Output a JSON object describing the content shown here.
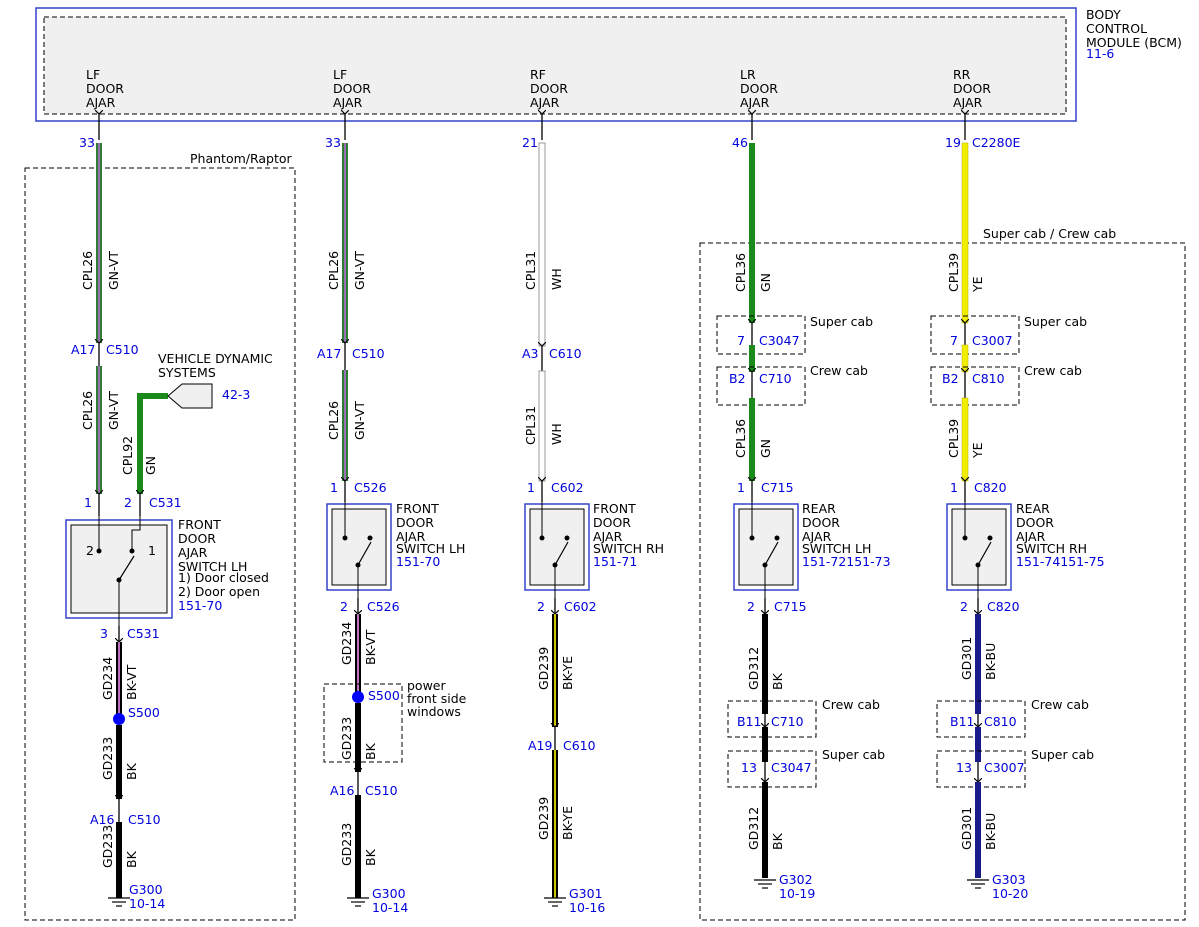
{
  "colors": {
    "gnvt_main": "#2e7d32",
    "gnvt_stripe": "#9b6fb5",
    "gn": "#1a8a1a",
    "wh": "#ffffff",
    "ye": "#f2ee00",
    "bkvt_stripe": "#c070c0",
    "bkye_stripe": "#cfc400",
    "bu": "#1a1a8a",
    "bk": "#000000",
    "ref": "#0000dd",
    "module_border": "#3344cc",
    "fill": "#f0f0f0"
  },
  "bcm": {
    "title_lines": [
      "BODY",
      "CONTROL",
      "MODULE (BCM)"
    ],
    "ref": "11-6",
    "pin_labels": [
      [
        "LF",
        "DOOR",
        "AJAR"
      ],
      [
        "LF",
        "DOOR",
        "AJAR"
      ],
      [
        "RF",
        "DOOR",
        "AJAR"
      ],
      [
        "LR",
        "DOOR",
        "AJAR"
      ],
      [
        "RR",
        "DOOR",
        "AJAR"
      ]
    ],
    "pin_numbers": [
      "33",
      "33",
      "21",
      "46",
      "19"
    ],
    "connector": "C2280E"
  },
  "regions": {
    "phantom": "Phantom/Raptor",
    "supercrew": "Super cab / Crew cab",
    "power_windows": [
      "power",
      "front side",
      "windows"
    ]
  },
  "vds": {
    "label_lines": [
      "VEHICLE DYNAMIC",
      "SYSTEMS"
    ],
    "ref": "42-3"
  },
  "wires": {
    "cpl26": "CPL26",
    "gnvt": "GN-VT",
    "cpl92": "CPL92",
    "gn": "GN",
    "cpl31": "CPL31",
    "wh": "WH",
    "cpl36": "CPL36",
    "cpl39": "CPL39",
    "ye": "YE",
    "gd234": "GD234",
    "bkvt": "BK-VT",
    "gd233": "GD233",
    "bk": "BK",
    "gd239": "GD239",
    "bkye": "BK-YE",
    "gd312": "GD312",
    "gd301": "GD301",
    "bkbu": "BK-BU"
  },
  "connectors": {
    "c510": "C510",
    "c610": "C610",
    "c531": "C531",
    "c526": "C526",
    "c602": "C602",
    "c715": "C715",
    "c820": "C820",
    "c3047": "C3047",
    "c3007": "C3007",
    "c710": "C710",
    "c810": "C810"
  },
  "pins": {
    "a17": "A17",
    "a3": "A3",
    "a16": "A16",
    "a19": "A19",
    "p1": "1",
    "p2": "2",
    "p3": "3",
    "p7": "7",
    "p13": "13",
    "b2": "B2",
    "b11": "B11"
  },
  "variants": {
    "super_cab": "Super cab",
    "crew_cab": "Crew cab"
  },
  "splices": {
    "s500": "S500"
  },
  "switches": {
    "lf1": {
      "lines": [
        "FRONT",
        "DOOR",
        "AJAR",
        "SWITCH LH",
        "1) Door closed",
        "2) Door open"
      ],
      "ref": "151-70"
    },
    "lf2": {
      "lines": [
        "FRONT",
        "DOOR",
        "AJAR",
        "SWITCH LH"
      ],
      "ref": "151-70"
    },
    "rf": {
      "lines": [
        "FRONT",
        "DOOR",
        "AJAR",
        "SWITCH RH"
      ],
      "ref": "151-71"
    },
    "lr": {
      "lines": [
        "REAR",
        "DOOR",
        "AJAR",
        "SWITCH LH"
      ],
      "ref": "151-72151-73"
    },
    "rr": {
      "lines": [
        "REAR",
        "DOOR",
        "AJAR",
        "SWITCH RH"
      ],
      "ref": "151-74151-75"
    }
  },
  "grounds": {
    "g1": {
      "name": "G300",
      "ref": "10-14"
    },
    "g2": {
      "name": "G300",
      "ref": "10-14"
    },
    "g3": {
      "name": "G301",
      "ref": "10-16"
    },
    "g4": {
      "name": "G302",
      "ref": "10-19"
    },
    "g5": {
      "name": "G303",
      "ref": "10-20"
    }
  }
}
